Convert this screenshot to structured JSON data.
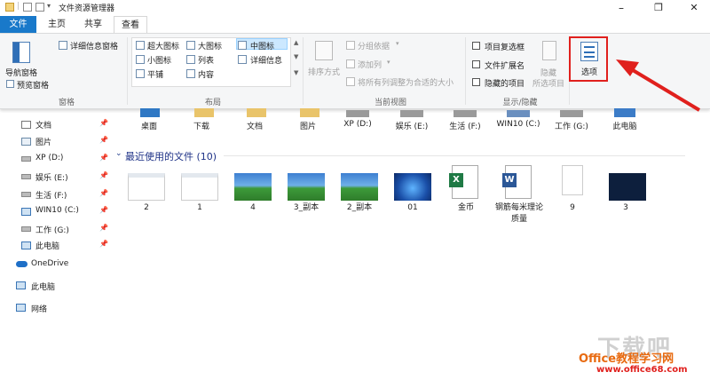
{
  "window": {
    "title": "文件资源管理器",
    "controls": [
      "–",
      "❐",
      "✕"
    ]
  },
  "tabs": [
    {
      "label": "文件"
    },
    {
      "label": "主页"
    },
    {
      "label": "共享"
    },
    {
      "label": "查看"
    }
  ],
  "ribbon": {
    "panes": {
      "nav_pane": "导航窗格",
      "preview_pane": "预览窗格",
      "details_pane": "详细信息窗格",
      "group": "窗格"
    },
    "layout": {
      "items": [
        "超大图标",
        "大图标",
        "中图标",
        "小图标",
        "列表",
        "详细信息",
        "平铺",
        "内容"
      ],
      "group": "布局"
    },
    "current_view": {
      "sort_by": "排序方式",
      "group_by": "分组依据",
      "add_column": "添加列",
      "fit_columns": "将所有列调整为合适的大小",
      "group": "当前视图"
    },
    "show_hide": {
      "checkbox_items": [
        "项目复选框",
        "文件扩展名",
        "隐藏的项目"
      ],
      "hide_selected_1": "隐藏",
      "hide_selected_2": "所选项目",
      "group": "显示/隐藏"
    },
    "options": "选项"
  },
  "nav": {
    "quick_items": [
      {
        "label": "文档",
        "pinned": true
      },
      {
        "label": "图片",
        "pinned": true
      },
      {
        "label": "XP (D:)",
        "pinned": true
      },
      {
        "label": "娱乐 (E:)",
        "pinned": true
      },
      {
        "label": "生活 (F:)",
        "pinned": true
      },
      {
        "label": "WIN10 (C:)",
        "pinned": true
      },
      {
        "label": "工作 (G:)",
        "pinned": true
      },
      {
        "label": "此电脑",
        "pinned": true
      }
    ],
    "onedrive": "OneDrive",
    "this_pc": "此电脑",
    "network": "网络",
    "pin_glyph": "📌"
  },
  "content": {
    "quick_access_items": [
      "桌面",
      "下载",
      "文档",
      "图片",
      "XP (D:)",
      "娱乐 (E:)",
      "生活 (F:)",
      "WIN10 (C:)",
      "工作 (G:)",
      "此电脑"
    ],
    "recent_header": "最近使用的文件 (10)",
    "recent_files": [
      {
        "label": "2",
        "kind": "doc-screenshot"
      },
      {
        "label": "1",
        "kind": "doc-screenshot"
      },
      {
        "label": "4",
        "kind": "landscape"
      },
      {
        "label": "3_副本",
        "kind": "landscape"
      },
      {
        "label": "2_副本",
        "kind": "landscape"
      },
      {
        "label": "01",
        "kind": "windows"
      },
      {
        "label": "金币",
        "kind": "excel"
      },
      {
        "label": "钢筋每米理论质量",
        "kind": "word"
      },
      {
        "label": "9",
        "kind": "page"
      },
      {
        "label": "3",
        "kind": "dark-screen"
      }
    ]
  },
  "watermark": {
    "line1": "下载吧",
    "line2": "Office教程学习网",
    "line3": "www.office68.com"
  },
  "colors": {
    "accent": "#1979ca",
    "annotation": "#e0201d",
    "ribbon_bg": "#f5f6f7"
  }
}
